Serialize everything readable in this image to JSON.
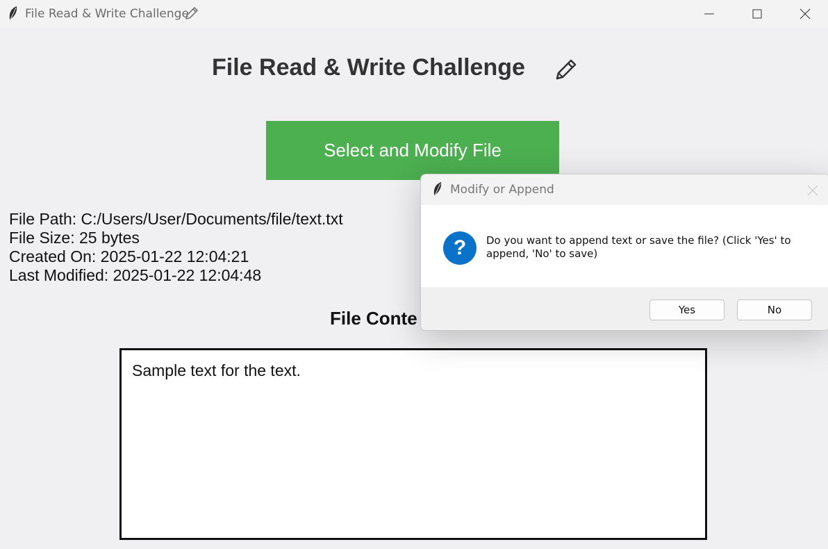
{
  "window": {
    "title": "File Read & Write Challenge",
    "title_icon": "feather-icon",
    "title_suffix_icon": "pencil-icon",
    "controls": [
      "minimize-icon",
      "maximize-icon",
      "close-icon"
    ]
  },
  "main": {
    "heading": "File Read & Write Challenge",
    "heading_icon": "pencil-icon",
    "select_button_label": "Select and Modify File",
    "select_button_color": "#4caf50",
    "file_info": {
      "path": "File Path: C:/Users/User/Documents/file/text.txt",
      "size": "File Size: 25 bytes",
      "created": "Created On: 2025-01-22 12:04:21",
      "modified": "Last Modified: 2025-01-22 12:04:48"
    },
    "content_heading": "File Conte",
    "file_content": "Sample text for the text."
  },
  "dialog": {
    "title": "Modify or Append",
    "icon": "question-icon",
    "icon_glyph": "?",
    "icon_color": "#0a72c8",
    "message": "Do you want to append text or save the file? (Click 'Yes' to append, 'No' to save)",
    "yes_label": "Yes",
    "no_label": "No"
  }
}
